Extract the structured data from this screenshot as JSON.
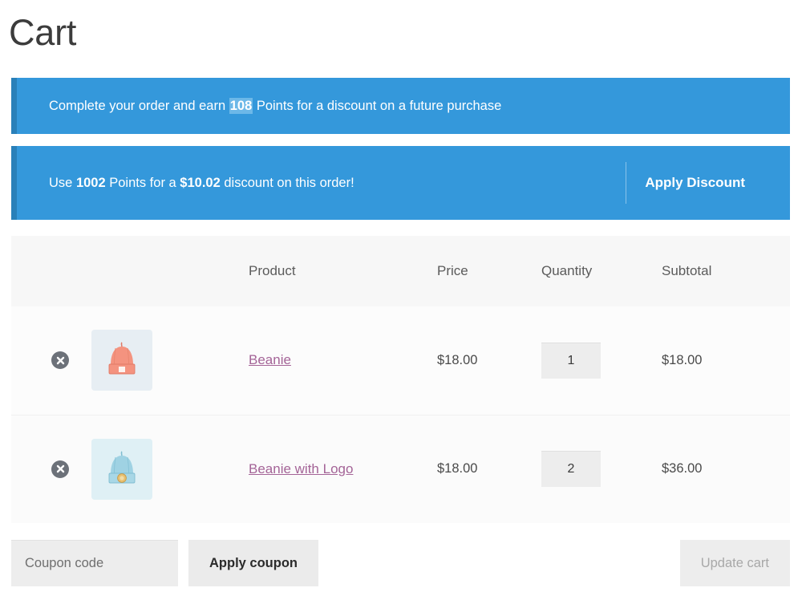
{
  "page": {
    "title": "Cart"
  },
  "notices": {
    "earn": {
      "prefix": "Complete your order and earn ",
      "points": "108",
      "suffix": " Points for a discount on a future purchase"
    },
    "redeem": {
      "prefix": "Use ",
      "points": "1002",
      "middle": " Points for a ",
      "amount": "$10.02",
      "suffix": " discount on this order!",
      "action_label": "Apply Discount"
    }
  },
  "colors": {
    "notice_background": "#3498db",
    "notice_border": "#2980b9",
    "highlight": "#6cb8e8",
    "product_link": "#a46497",
    "remove_button": "#6c7179"
  },
  "table": {
    "headers": {
      "remove": "",
      "thumbnail": "",
      "product": "Product",
      "price": "Price",
      "quantity": "Quantity",
      "subtotal": "Subtotal"
    },
    "rows": [
      {
        "remove_icon": "remove-item-icon",
        "thumbnail_icon": "beanie-thumbnail",
        "product": "Beanie",
        "price": "$18.00",
        "quantity": "1",
        "subtotal": "$18.00"
      },
      {
        "remove_icon": "remove-item-icon",
        "thumbnail_icon": "beanie-with-logo-thumbnail",
        "product": "Beanie with Logo",
        "price": "$18.00",
        "quantity": "2",
        "subtotal": "$36.00"
      }
    ]
  },
  "actions": {
    "coupon_placeholder": "Coupon code",
    "coupon_value": "",
    "apply_coupon_label": "Apply coupon",
    "update_cart_label": "Update cart"
  }
}
